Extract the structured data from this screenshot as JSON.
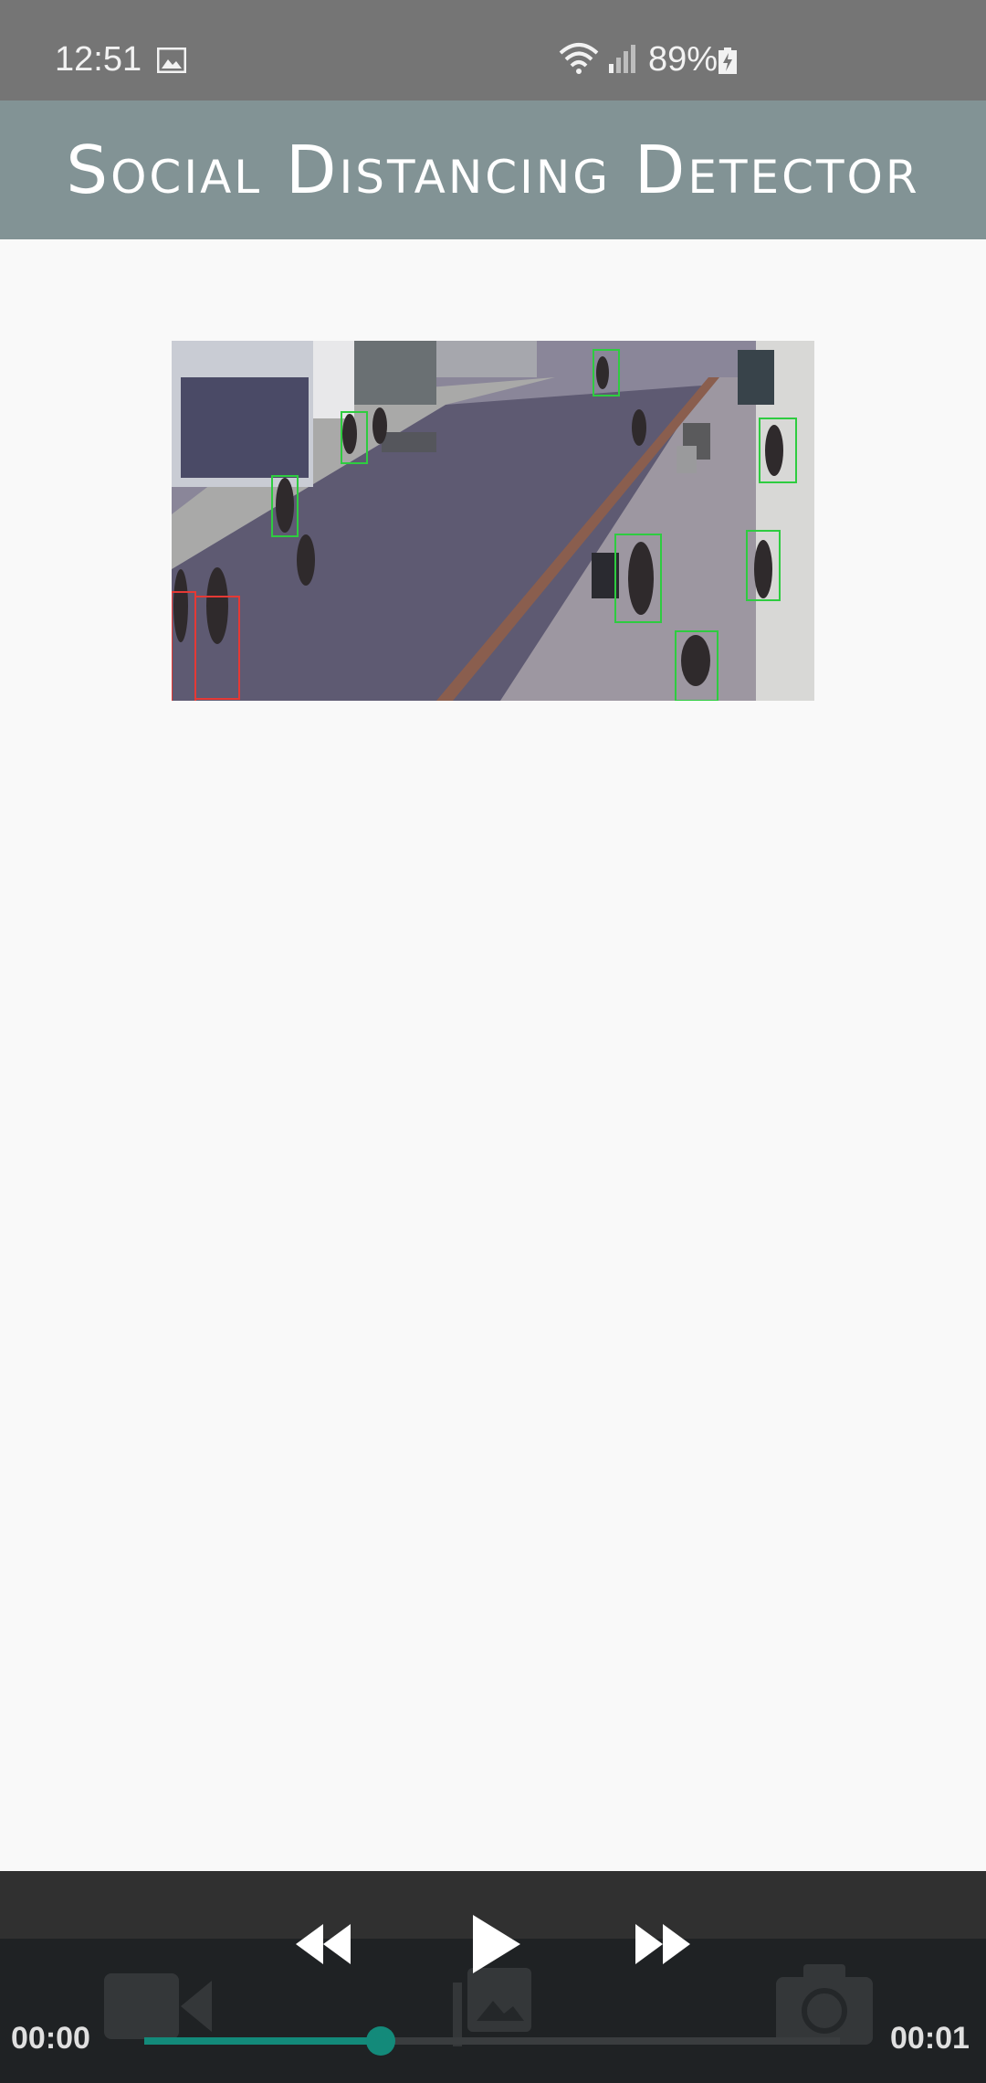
{
  "status_bar": {
    "time": "12:51",
    "battery": "89%",
    "icons": [
      "image-icon",
      "wifi-icon",
      "signal-icon",
      "battery-charging-icon"
    ]
  },
  "app_bar": {
    "title": "Social Distancing Detector",
    "background_color": "#829395"
  },
  "video": {
    "description_icon": "video-frame",
    "box_colors": {
      "safe": "#2ecc40",
      "violation": "#e53935"
    }
  },
  "player": {
    "current_time": "00:00",
    "total_time": "00:01",
    "progress": 0.34,
    "accent_color": "#138a7a",
    "buttons": {
      "rewind": "rewind-icon",
      "play": "play-icon",
      "fast_forward": "fast-forward-icon"
    },
    "background_icons": [
      "video-camera-icon",
      "gallery-icon",
      "camera-icon"
    ]
  }
}
